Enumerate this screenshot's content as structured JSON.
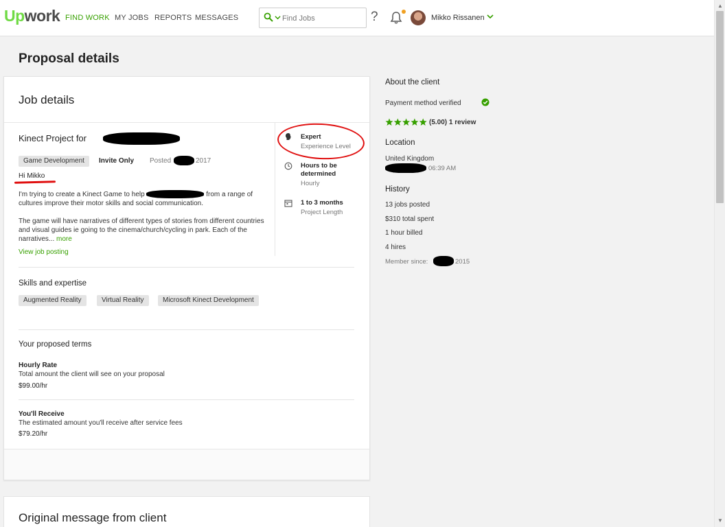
{
  "nav": {
    "logo_up": "Up",
    "logo_work": "work",
    "find_work": "FIND WORK",
    "my_jobs": "MY JOBS",
    "reports": "REPORTS",
    "messages": "MESSAGES",
    "search_placeholder": "Find Jobs",
    "help": "?",
    "user_name": "Mikko Rissanen"
  },
  "page": {
    "title": "Proposal details"
  },
  "job": {
    "card_title": "Job details",
    "title_prefix": "Kinect Project for",
    "category": "Game Development",
    "invite": "Invite Only",
    "posted_label": "Posted",
    "posted_year": "2017",
    "greeting": "Hi Mikko",
    "desc_p1_a": "I'm trying to create a Kinect Game to help",
    "desc_p1_b": "from a range of cultures improve their motor skills and social communication.",
    "desc_p2": "The game will have narratives of different types of stories from different countries and visual guides ie going to the cinema/church/cycling in park. Each of the narratives...",
    "more": "more",
    "view_posting": "View job posting",
    "experience_value": "Expert",
    "experience_label": "Experience Level",
    "hours_value": "Hours to be determined",
    "hours_label": "Hourly",
    "length_value": "1 to 3 months",
    "length_label": "Project Length"
  },
  "skills": {
    "title": "Skills and expertise",
    "items": [
      "Augmented Reality",
      "Virtual Reality",
      "Microsoft Kinect Development"
    ]
  },
  "terms": {
    "title": "Your proposed terms",
    "rate_label": "Hourly Rate",
    "rate_desc": "Total amount the client will see on your proposal",
    "rate_value": "$99.00/hr",
    "receive_label": "You'll Receive",
    "receive_desc": "The estimated amount you'll receive after service fees",
    "receive_value": "$79.20/hr"
  },
  "original_message": {
    "title": "Original message from client"
  },
  "client": {
    "about_title": "About the client",
    "payment": "Payment method verified",
    "rating_stars": 5,
    "rating_text": "(5.00) 1 review",
    "location_title": "Location",
    "country": "United Kingdom",
    "local_time": "06:39 AM",
    "history_title": "History",
    "jobs_posted": "13 jobs posted",
    "total_spent": "$310 total spent",
    "hours_billed": "1 hour billed",
    "hires": "4 hires",
    "member_since_label": "Member since:",
    "member_since_year": "2015"
  },
  "colors": {
    "brand_green": "#37a000",
    "logo_green": "#6fda44",
    "annotation_red": "#e01010",
    "notification_dot": "#f0a020"
  }
}
